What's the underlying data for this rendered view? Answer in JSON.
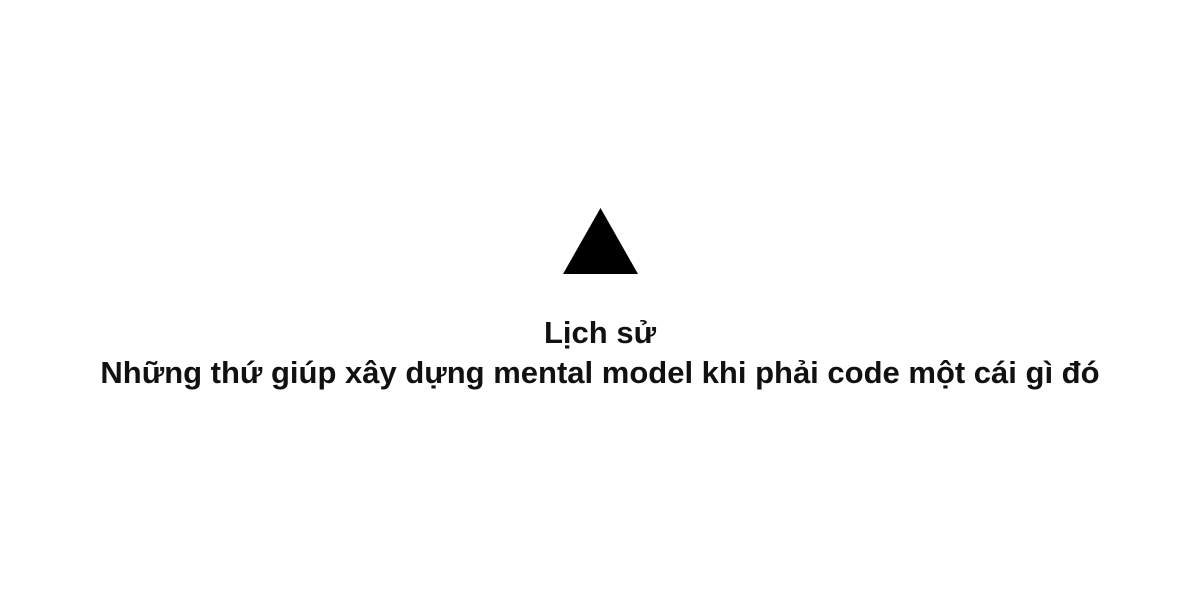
{
  "logo": {
    "icon": "triangle-logo-icon",
    "color": "#000000"
  },
  "heading": {
    "title": "Lịch sử",
    "subtitle": "Những thứ giúp xây dựng mental model khi phải code một cái gì đó"
  },
  "colors": {
    "background": "#ffffff",
    "text": "#111111"
  }
}
